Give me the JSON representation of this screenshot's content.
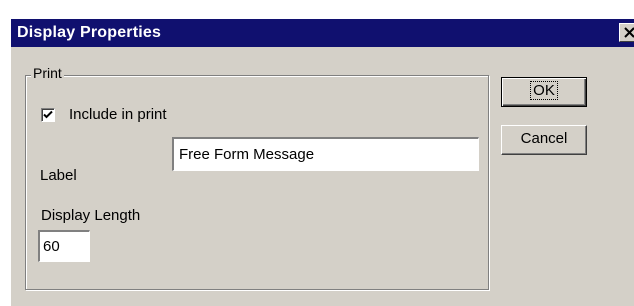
{
  "window": {
    "title": "Display Properties",
    "close_icon": "close-icon"
  },
  "print_group": {
    "legend": "Print",
    "include_checkbox": {
      "label": "Include in print",
      "checked": true
    },
    "label_field": {
      "label": "Label",
      "value": "Free Form Message"
    },
    "length_field": {
      "label": "Display Length",
      "value": "60"
    }
  },
  "buttons": {
    "ok": "OK",
    "cancel": "Cancel"
  },
  "colors": {
    "titlebar": "#10106f",
    "dialog_face": "#d4d0c8"
  }
}
